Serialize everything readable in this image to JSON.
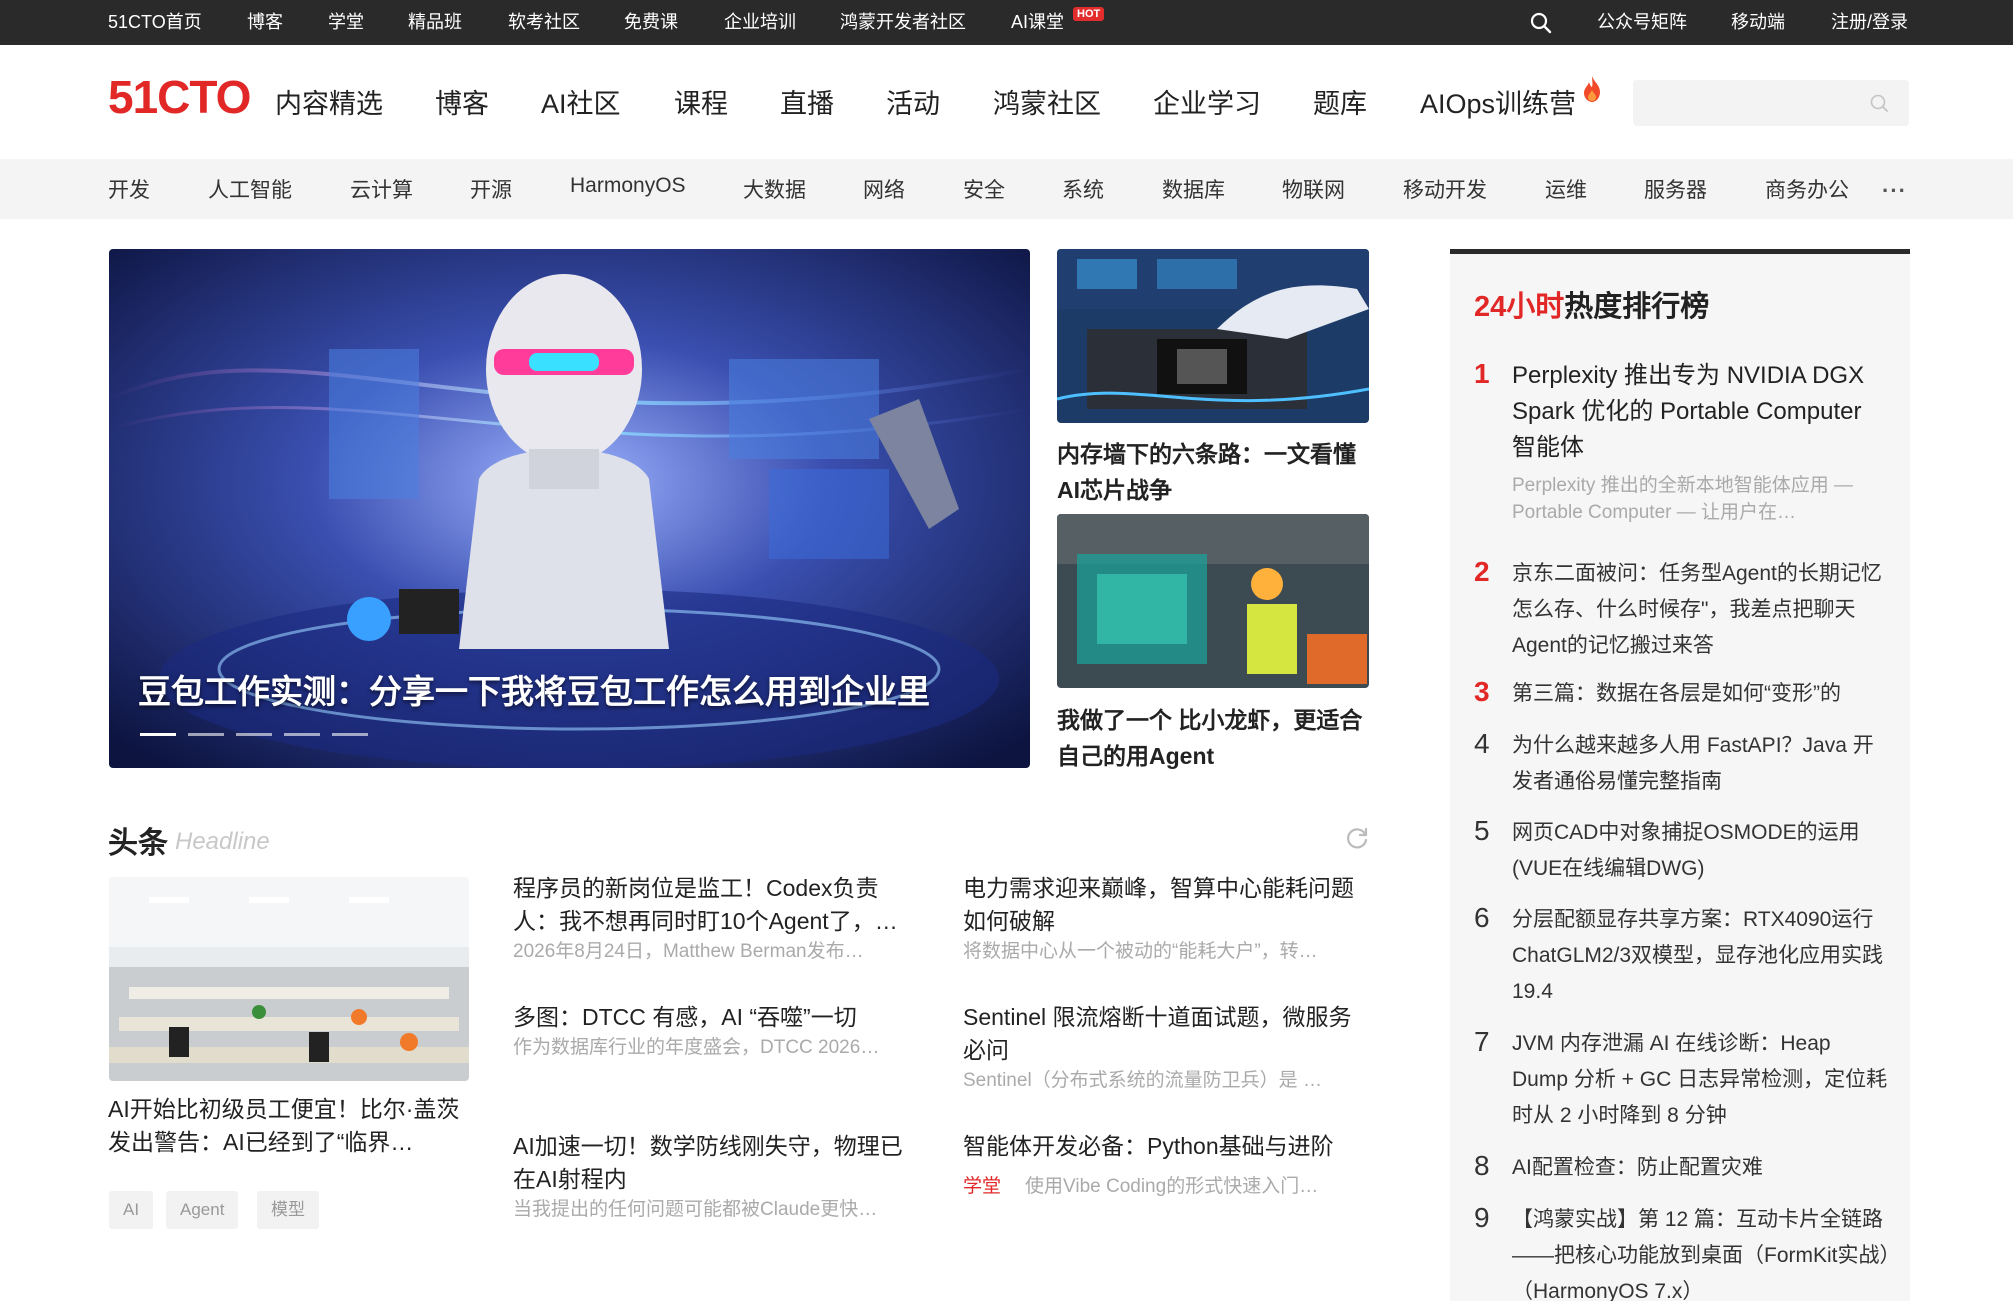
{
  "topbar": {
    "links": [
      "51CTO首页",
      "博客",
      "学堂",
      "精品班",
      "软考社区",
      "免费课",
      "企业培训",
      "鸿蒙开发者社区",
      "AI课堂"
    ],
    "hot_badge": "HOT",
    "right_links": [
      "公众号矩阵",
      "移动端",
      "注册/登录"
    ],
    "search_icon": "search-icon"
  },
  "mainnav": {
    "logo": "51CTO",
    "items": [
      "内容精选",
      "博客",
      "AI社区",
      "课程",
      "直播",
      "活动",
      "鸿蒙社区",
      "企业学习",
      "题库",
      "AIOps训练营"
    ],
    "fire_icon": "fire-icon",
    "search_placeholder": ""
  },
  "categories": [
    "开发",
    "人工智能",
    "云计算",
    "开源",
    "HarmonyOS",
    "大数据",
    "网络",
    "安全",
    "系统",
    "数据库",
    "物联网",
    "移动开发",
    "运维",
    "服务器",
    "商务办公"
  ],
  "more_label": "···",
  "hero": {
    "title": "豆包工作实测：分享一下我将豆包工作怎么用到企业里",
    "slide_count": 5,
    "active_slide": 1
  },
  "side_cards": [
    {
      "title": "内存墙下的六条路：一文看懂AI芯片战争"
    },
    {
      "title": "我做了一个 比小龙虾，更适合自己的用Agent"
    }
  ],
  "headline": {
    "title": "头条",
    "subtitle": "Headline",
    "main_title": "AI开始比初级员工便宜！比尔·盖茨发出警告：AI已经到了“临界…",
    "tags": [
      "AI",
      "Agent",
      "模型"
    ],
    "articles": [
      {
        "title": "程序员的新岗位是监工！Codex负责人：我不想再同时盯10个Agent了，…",
        "desc": "2026年8月24日，Matthew Berman发布…"
      },
      {
        "title": "电力需求迎来巅峰，智算中心能耗问题如何破解",
        "desc": "将数据中心从一个被动的“能耗大户”，转…"
      },
      {
        "title": "多图：DTCC 有感，AI “吞噬”一切",
        "desc": "作为数据库行业的年度盛会，DTCC 2026…"
      },
      {
        "title": "Sentinel 限流熔断十道面试题，微服务必问",
        "desc": "Sentinel（分布式系统的流量防卫兵）是 …"
      },
      {
        "title": "AI加速一切！数学防线刚失守，物理已在AI射程内",
        "desc": "当我提出的任何问题可能都被Claude更快…"
      },
      {
        "title": "智能体开发必备：Python基础与进阶",
        "tag": "学堂",
        "desc": "使用Vibe Coding的形式快速入门…"
      }
    ]
  },
  "hot_rank": {
    "title_red": "24小时",
    "title_black": "热度排行榜",
    "items": [
      {
        "num": "1",
        "text": "Perplexity 推出专为 NVIDIA DGX Spark 优化的 Portable Computer 智能体",
        "desc": "Perplexity 推出的全新本地智能体应用 — Portable Computer — 让用户在…"
      },
      {
        "num": "2",
        "text": "京东二面被问：任务型Agent的长期记忆怎么存、什么时候存\"，我差点把聊天Agent的记忆搬过来答"
      },
      {
        "num": "3",
        "text": "第三篇：数据在各层是如何“变形”的"
      },
      {
        "num": "4",
        "text": "为什么越来越多人用 FastAPI？Java 开发者通俗易懂完整指南"
      },
      {
        "num": "5",
        "text": "网页CAD中对象捕捉OSMODE的运用(VUE在线编辑DWG)"
      },
      {
        "num": "6",
        "text": "分层配额显存共享方案：RTX4090运行ChatGLM2/3双模型，显存池化应用实践19.4"
      },
      {
        "num": "7",
        "text": "JVM 内存泄漏 AI 在线诊断：Heap Dump 分析 + GC 日志异常检测，定位耗时从 2 小时降到 8 分钟"
      },
      {
        "num": "8",
        "text": "AI配置检查：防止配置灾难"
      },
      {
        "num": "9",
        "text": "【鸿蒙实战】第 12 篇：互动卡片全链路——把核心功能放到桌面（FormKit实战）（HarmonyOS 7.x）"
      }
    ]
  }
}
